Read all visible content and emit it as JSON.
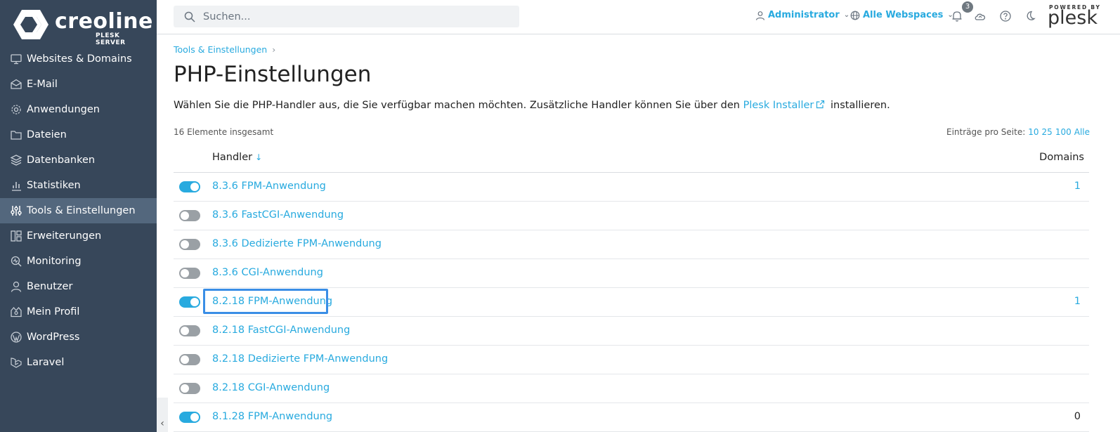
{
  "brand": {
    "name": "creoline",
    "sub": "PLESK SERVER"
  },
  "sidebar": {
    "items": [
      {
        "label": "Websites & Domains",
        "icon": "monitor-icon"
      },
      {
        "label": "E-Mail",
        "icon": "envelope-icon"
      },
      {
        "label": "Anwendungen",
        "icon": "gear-icon"
      },
      {
        "label": "Dateien",
        "icon": "folder-icon"
      },
      {
        "label": "Datenbanken",
        "icon": "database-icon"
      },
      {
        "label": "Statistiken",
        "icon": "bar-chart-icon"
      },
      {
        "label": "Tools & Einstellungen",
        "icon": "sliders-icon",
        "active": true
      },
      {
        "label": "Erweiterungen",
        "icon": "extensions-icon"
      },
      {
        "label": "Monitoring",
        "icon": "monitoring-icon"
      },
      {
        "label": "Benutzer",
        "icon": "user-icon"
      },
      {
        "label": "Mein Profil",
        "icon": "profile-icon"
      },
      {
        "label": "WordPress",
        "icon": "wordpress-icon"
      },
      {
        "label": "Laravel",
        "icon": "laravel-icon"
      }
    ],
    "collapse_glyph": "‹"
  },
  "topbar": {
    "search_placeholder": "Suchen...",
    "user": "Administrator",
    "webspaces": "Alle Webspaces",
    "notifications_count": "3",
    "powered_by": "POWERED BY",
    "plesk": "plesk"
  },
  "breadcrumb": {
    "item": "Tools & Einstellungen",
    "sep": "›"
  },
  "page": {
    "title": "PHP-Einstellungen",
    "desc_before": "Wählen Sie die PHP-Handler aus, die Sie verfügbar machen möchten. Zusätzliche Handler können Sie über den",
    "desc_link": "Plesk Installer",
    "desc_after": "installieren.",
    "total": "16 Elemente insgesamt",
    "perpage_label": "Einträge pro Seite:",
    "perpage_options": [
      "10",
      "25",
      "100",
      "Alle"
    ]
  },
  "table": {
    "col_handler": "Handler",
    "col_sort": "↓",
    "col_domains": "Domains",
    "rows": [
      {
        "name": "8.3.6 FPM-Anwendung",
        "enabled": true,
        "domains": "1",
        "domains_link": true
      },
      {
        "name": "8.3.6 FastCGI-Anwendung",
        "enabled": false,
        "domains": ""
      },
      {
        "name": "8.3.6 Dedizierte FPM-Anwendung",
        "enabled": false,
        "domains": ""
      },
      {
        "name": "8.3.6 CGI-Anwendung",
        "enabled": false,
        "domains": ""
      },
      {
        "name": "8.2.18 FPM-Anwendung",
        "enabled": true,
        "domains": "1",
        "domains_link": true,
        "highlighted": true
      },
      {
        "name": "8.2.18 FastCGI-Anwendung",
        "enabled": false,
        "domains": ""
      },
      {
        "name": "8.2.18 Dedizierte FPM-Anwendung",
        "enabled": false,
        "domains": ""
      },
      {
        "name": "8.2.18 CGI-Anwendung",
        "enabled": false,
        "domains": ""
      },
      {
        "name": "8.1.28 FPM-Anwendung",
        "enabled": true,
        "domains": "0",
        "domains_link": false
      }
    ]
  },
  "colors": {
    "sidebar_bg": "#37475a",
    "active_bg": "#53677d",
    "accent": "#28aadf",
    "highlight": "#3a8ee6"
  }
}
